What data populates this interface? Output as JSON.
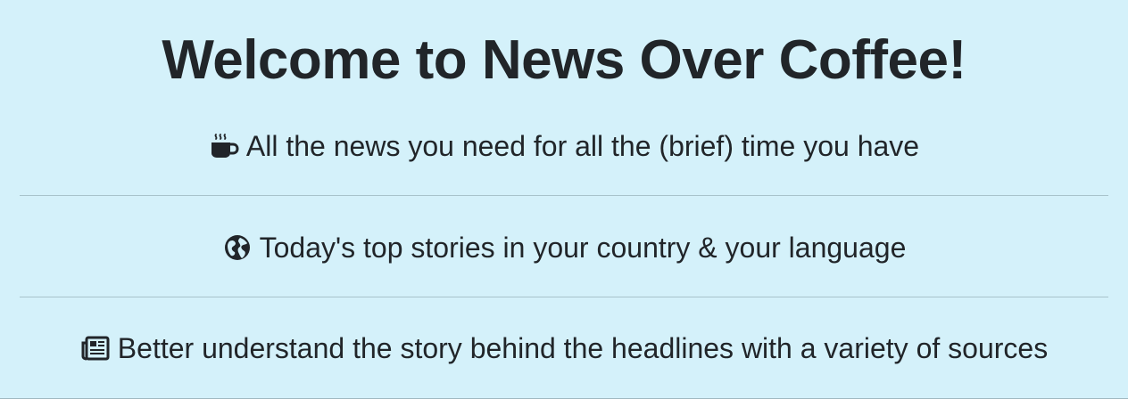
{
  "hero": {
    "title": "Welcome to News Over Coffee!"
  },
  "features": [
    {
      "icon": "coffee-cup-icon",
      "text": "All the news you need for all the (brief) time you have"
    },
    {
      "icon": "globe-icon",
      "text": "Today's top stories in your country & your language"
    },
    {
      "icon": "newspaper-icon",
      "text": "Better understand the story behind the headlines with a variety of sources"
    }
  ],
  "colors": {
    "background": "#d4f1fa",
    "text": "#212529",
    "divider": "#a8c3cb"
  }
}
